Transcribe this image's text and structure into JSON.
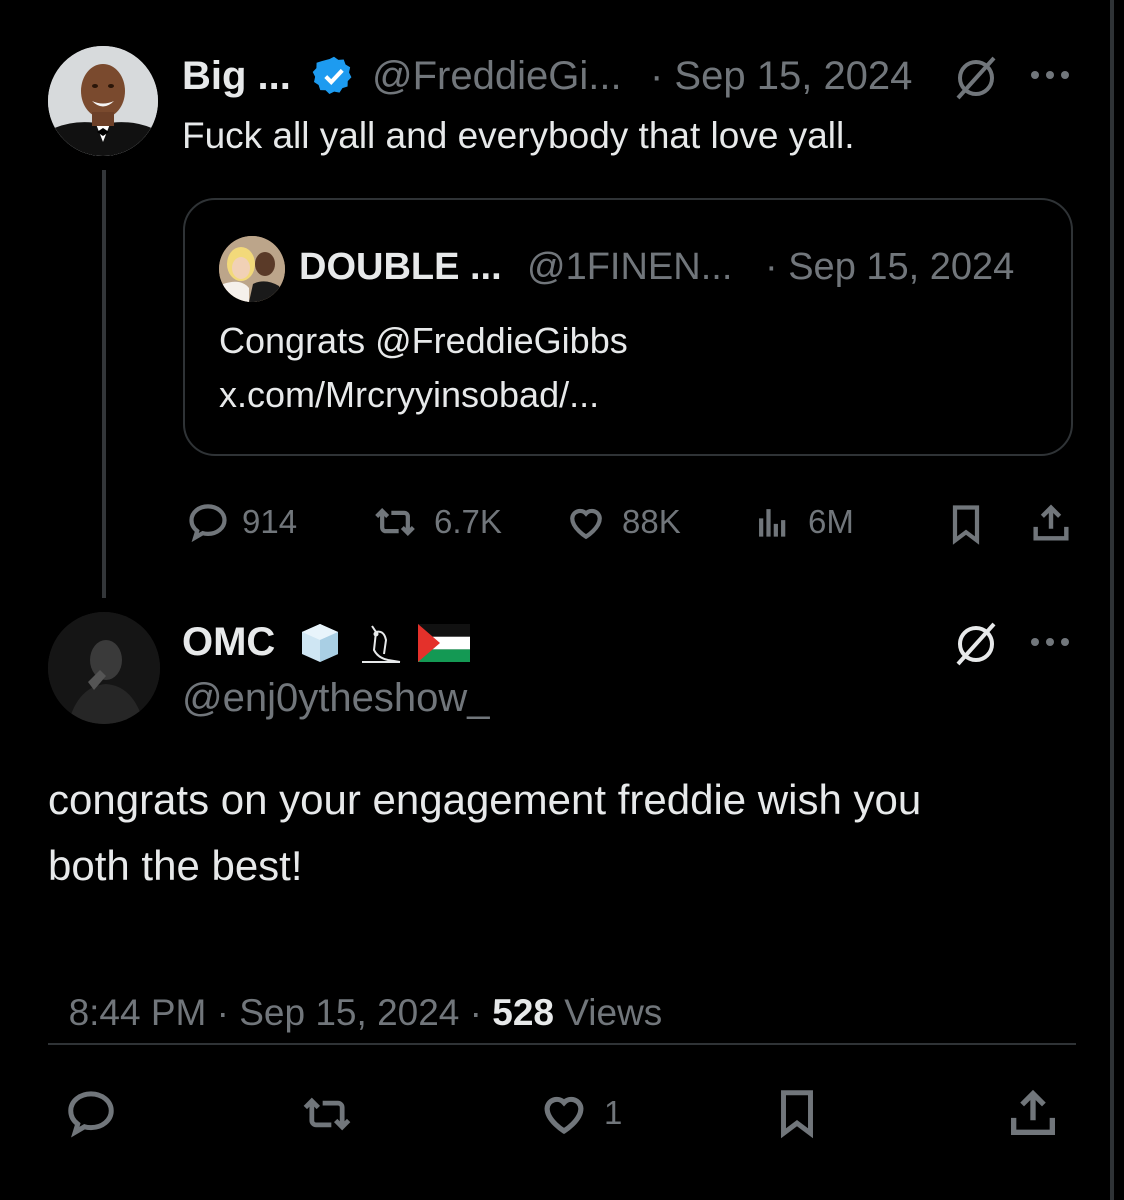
{
  "colors": {
    "background": "#000000",
    "text": "#e7e9ea",
    "muted": "#71767b",
    "verified": "#1d9bf0",
    "border": "#2f3336"
  },
  "parent_tweet": {
    "author_name": "Big ...",
    "handle": "@FreddieGi...",
    "separator_date": "· Sep 15, 2024",
    "text": "Fuck all yall and everybody that love yall.",
    "verified_icon": "verified-badge-icon",
    "quote": {
      "author_name": "DOUBLE ...",
      "handle": "@1FINEN...",
      "separator_date": "· Sep 15, 2024",
      "line1": "Congrats @FreddieGibbs",
      "line2": "x.com/Mrcryyinsobad/..."
    },
    "stats": {
      "replies": "914",
      "reposts": "6.7K",
      "likes": "88K",
      "views": "6M"
    }
  },
  "reply_tweet": {
    "author_name": "OMC",
    "emojis": [
      "ice-cube-icon",
      "owl-icon",
      "palestine-flag-icon"
    ],
    "handle": "@enj0ytheshow_",
    "text_line1": "congrats on your engagement freddie wish you",
    "text_line2": "both the best!",
    "meta_time": "8:44 PM · Sep 15, 2024 · ",
    "views_count": "528",
    "views_label": " Views",
    "likes": "1"
  }
}
